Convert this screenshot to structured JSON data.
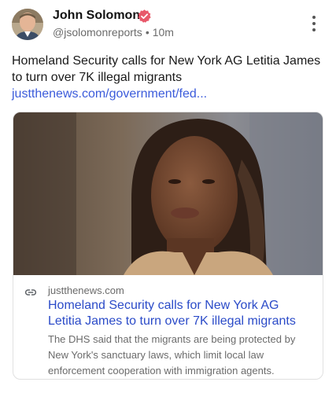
{
  "author": {
    "name": "John Solomon",
    "handle": "@jsolomonreports",
    "separator": "•",
    "time": "10m",
    "verified_color": "#e8586a"
  },
  "post": {
    "text": "Homeland Security calls for New York AG Letitia James to turn over 7K illegal migrants",
    "link_text": "justthenews.com/government/fed..."
  },
  "card": {
    "domain": "justthenews.com",
    "title": "Homeland Security calls for New York AG Letitia James to turn over 7K illegal migrants",
    "description": "The DHS said that the migrants are being protected by New York's sanctuary laws, which limit local law enforcement cooperation with immigration agents."
  },
  "icons": {
    "verified": "verified-badge-icon",
    "more": "more-vertical-icon",
    "link": "link-icon"
  },
  "colors": {
    "link": "#3b5bdb",
    "card_title": "#2b4bc8",
    "muted": "#6b6b6b"
  }
}
